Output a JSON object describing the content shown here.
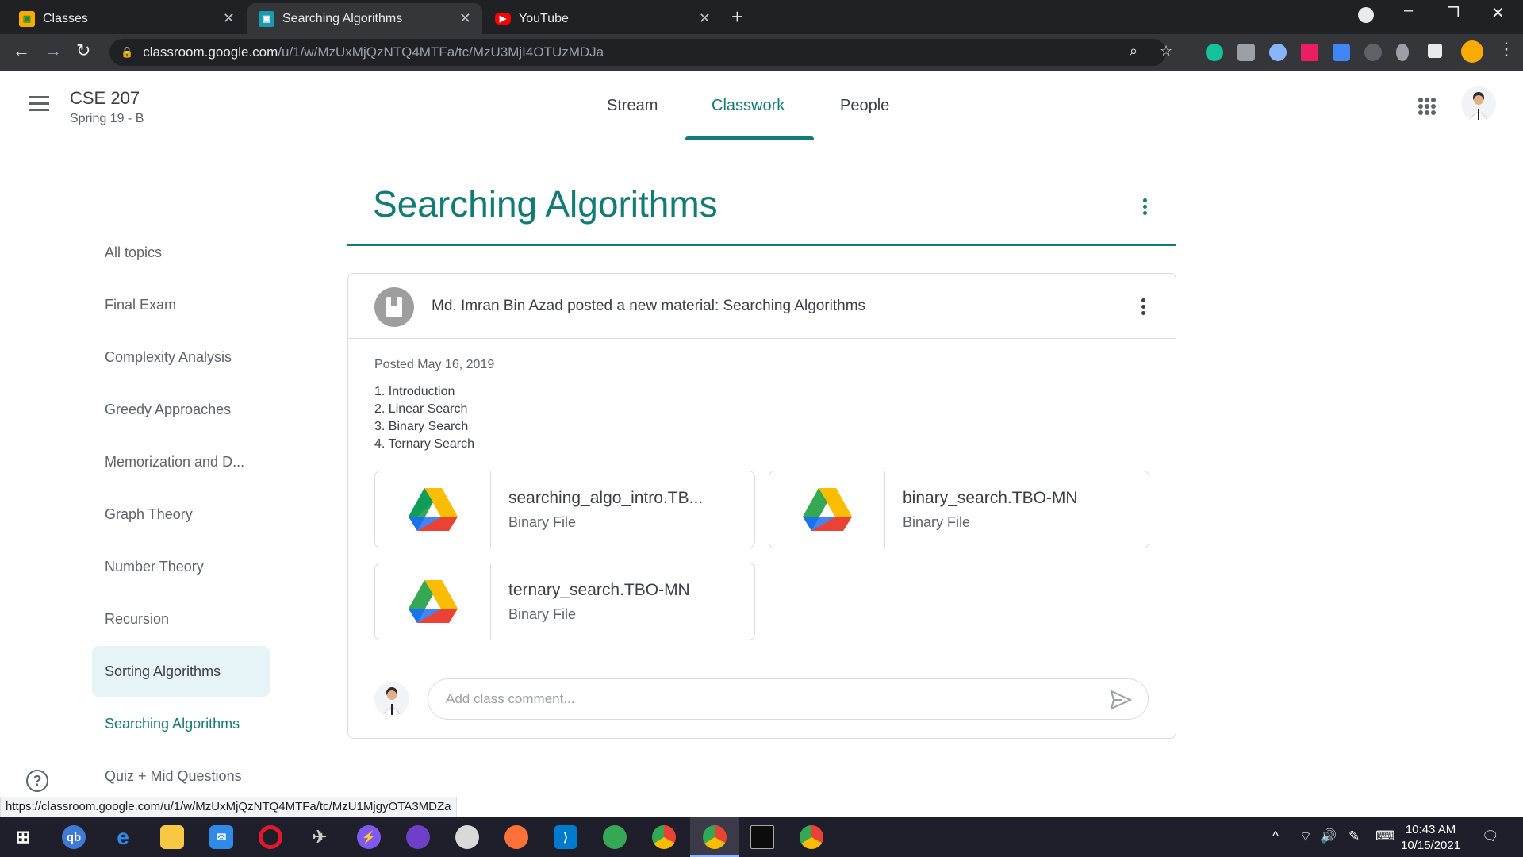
{
  "browser": {
    "tabs": [
      {
        "title": "Classes"
      },
      {
        "title": "Searching Algorithms"
      },
      {
        "title": "YouTube"
      }
    ],
    "url_domain": "classroom.google.com",
    "url_path": "/u/1/w/MzUxMjQzNTQ4MTFa/tc/MzU3MjI4OTUzMDJa",
    "status_url": "https://classroom.google.com/u/1/w/MzUxMjQzNTQ4MTFa/tc/MzU1MjgyOTA3MDZa"
  },
  "classroom": {
    "class_name": "CSE 207",
    "section": "Spring 19 - B",
    "nav_tabs": [
      "Stream",
      "Classwork",
      "People"
    ],
    "active_tab": "Classwork"
  },
  "sidebar": {
    "items": [
      {
        "label": "All topics"
      },
      {
        "label": "Final Exam"
      },
      {
        "label": "Complexity Analysis"
      },
      {
        "label": "Greedy Approaches"
      },
      {
        "label": "Memorization and D..."
      },
      {
        "label": "Graph Theory"
      },
      {
        "label": "Number Theory"
      },
      {
        "label": "Recursion"
      },
      {
        "label": "Sorting Algorithms"
      },
      {
        "label": "Searching Algorithms"
      },
      {
        "label": "Quiz + Mid Questions"
      }
    ]
  },
  "topic": {
    "title": "Searching Algorithms"
  },
  "post": {
    "title": "Md. Imran Bin Azad posted a new material: Searching Algorithms",
    "posted": "Posted May 16, 2019",
    "description": [
      "1. Introduction",
      "2. Linear Search",
      "3. Binary Search",
      "4. Ternary Search"
    ],
    "attachments": [
      {
        "name": "searching_algo_intro.TB...",
        "type": "Binary File"
      },
      {
        "name": "binary_search.TBO-MN",
        "type": "Binary File"
      },
      {
        "name": "ternary_search.TBO-MN",
        "type": "Binary File"
      }
    ],
    "comment_placeholder": "Add class comment..."
  },
  "taskbar": {
    "time": "10:43 AM",
    "date": "10/15/2021"
  },
  "colors": {
    "accent": "#137b75",
    "sidebar_selected": "#e6f4f8",
    "chrome_dark": "#202124"
  }
}
